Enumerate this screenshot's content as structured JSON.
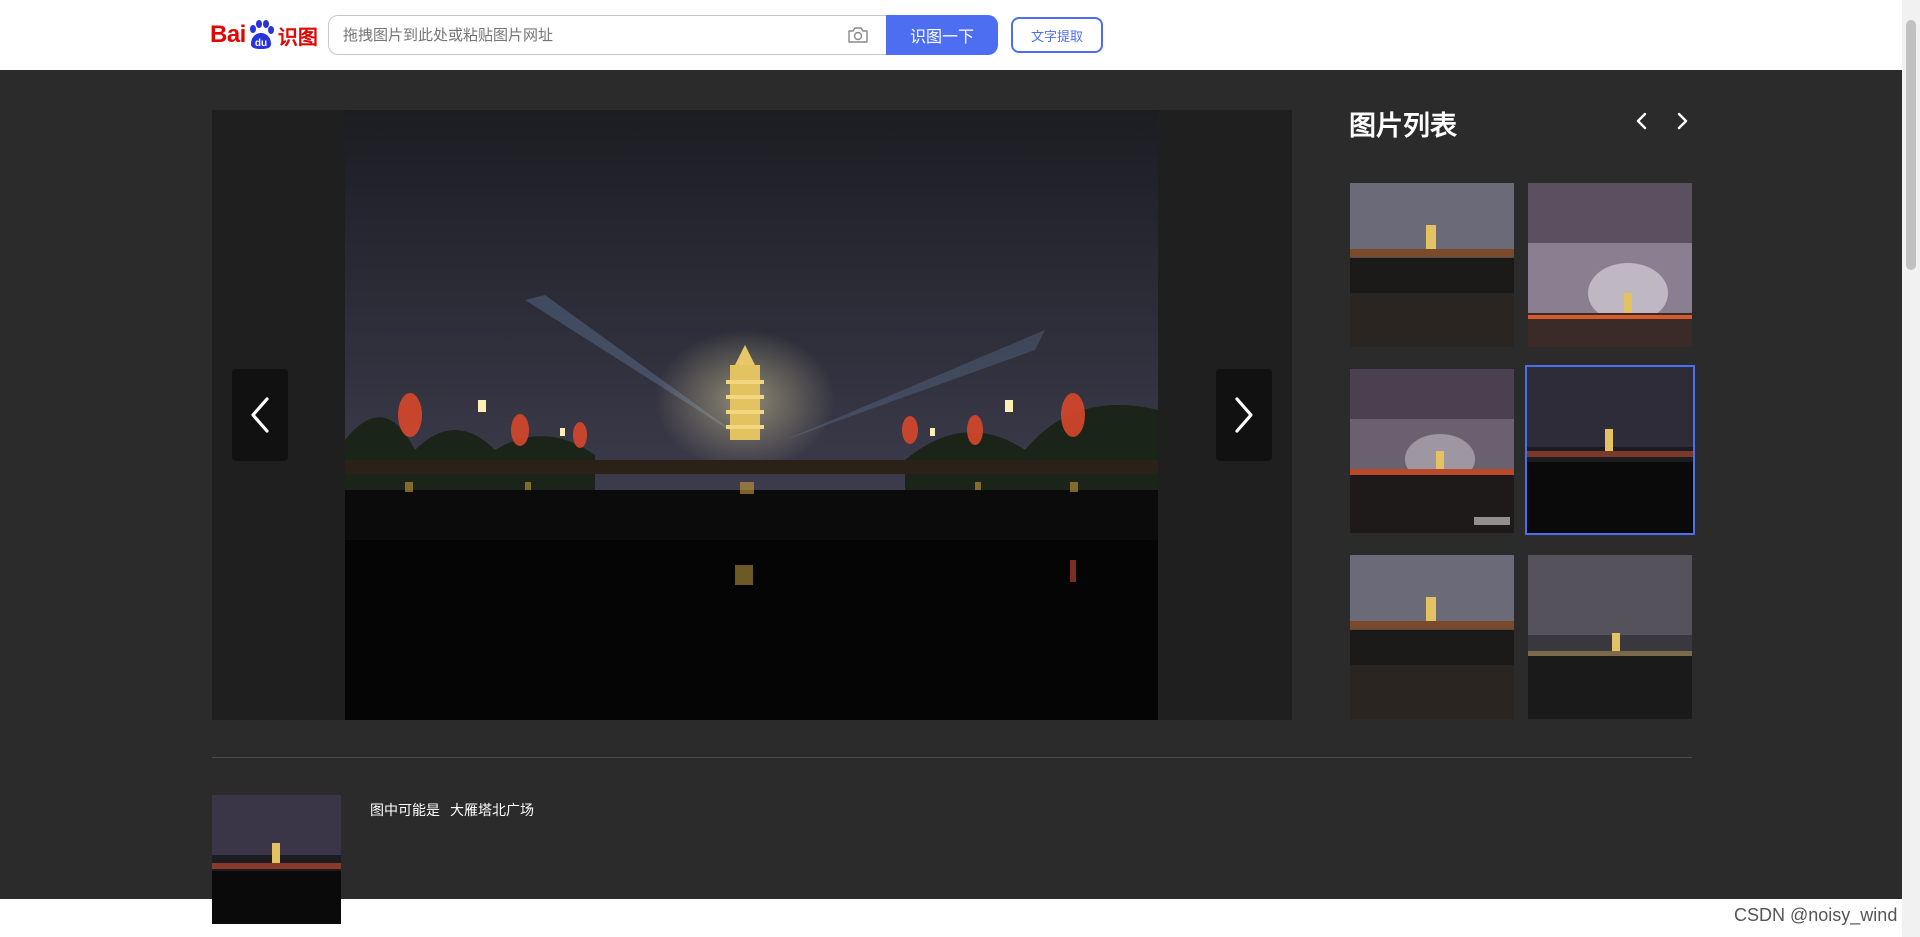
{
  "header": {
    "logo_prefix": "Bai",
    "logo_du": "du",
    "logo_suffix": "识图",
    "search_placeholder": "拖拽图片到此处或粘贴图片网址",
    "search_button": "识图一下",
    "text_extract_button": "文字提取"
  },
  "panel": {
    "title": "图片列表",
    "thumbnails": [
      {
        "name": "thumb-1",
        "selected": false
      },
      {
        "name": "thumb-2",
        "selected": false
      },
      {
        "name": "thumb-3",
        "selected": false
      },
      {
        "name": "thumb-4",
        "selected": true
      },
      {
        "name": "thumb-5",
        "selected": false
      },
      {
        "name": "thumb-6",
        "selected": false
      }
    ]
  },
  "result": {
    "prefix": "图中可能是",
    "location": "大雁塔北广场"
  },
  "watermark": "CSDN @noisy_wind",
  "colors": {
    "accent": "#4e6ef2",
    "brand_red": "#e10602",
    "background": "#2b2b2b"
  },
  "icons": [
    "camera-icon",
    "chevron-left-icon",
    "chevron-right-icon",
    "paw-icon"
  ]
}
